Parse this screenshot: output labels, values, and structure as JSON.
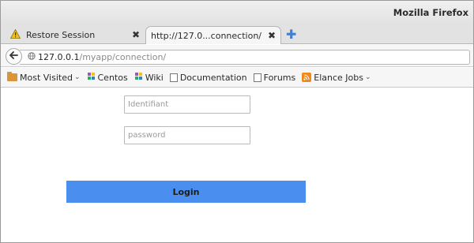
{
  "window": {
    "title": "Mozilla Firefox"
  },
  "tabs": [
    {
      "label": "Restore Session",
      "icon": "warning-icon",
      "close": "✖"
    },
    {
      "label": "http://127.0...connection/",
      "close": "✖"
    }
  ],
  "new_tab": {
    "icon": "plus-icon",
    "glyph": "✚"
  },
  "navbar": {
    "back_glyph": "🡐",
    "url_host": "127.0.0.1",
    "url_path": "/myapp/connection/"
  },
  "bookmarks": [
    {
      "label": "Most Visited",
      "icon": "folder-icon",
      "has_dropdown": true
    },
    {
      "label": "Centos",
      "icon": "centos-icon"
    },
    {
      "label": "Wiki",
      "icon": "wiki-icon"
    },
    {
      "label": "Documentation",
      "icon": "page-icon"
    },
    {
      "label": "Forums",
      "icon": "page-icon"
    },
    {
      "label": "Elance Jobs",
      "icon": "rss-icon",
      "has_dropdown": true
    }
  ],
  "form": {
    "identifiant_placeholder": "Identifiant",
    "password_placeholder": "password",
    "login_label": "Login"
  },
  "colors": {
    "login_button": "#4a8ef0",
    "new_tab": "#3d7fd9",
    "rss": "#f0891b"
  }
}
